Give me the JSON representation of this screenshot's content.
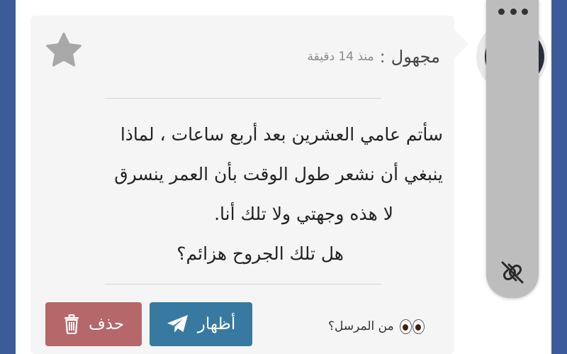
{
  "post": {
    "author": "مجهول",
    "separator": ":",
    "time": "منذ 14 دقيقة",
    "message_lines": [
      "سأتم عامي العشرين بعد أربع ساعات ، لماذا",
      "ينبغي أن نشعر طول الوقت بأن العمر ينسرق",
      "لا هذه وجهتي ولا تلك أنا.",
      "هل تلك الجروح هزائم؟"
    ]
  },
  "actions": {
    "delete_label": "حذف",
    "show_label": "أظهار",
    "sender_question": "من المرسل؟"
  },
  "icons": {
    "favorite": "star-icon",
    "delete": "trash-icon",
    "show": "send-icon",
    "sender": "eyes-icon",
    "menu": "more-dots-icon",
    "unlink": "no-link-icon"
  },
  "colors": {
    "background_blue": "#3b5b9a",
    "delete_button": "#b5676a",
    "show_button": "#3779a0",
    "star": "#a8a8a8"
  }
}
